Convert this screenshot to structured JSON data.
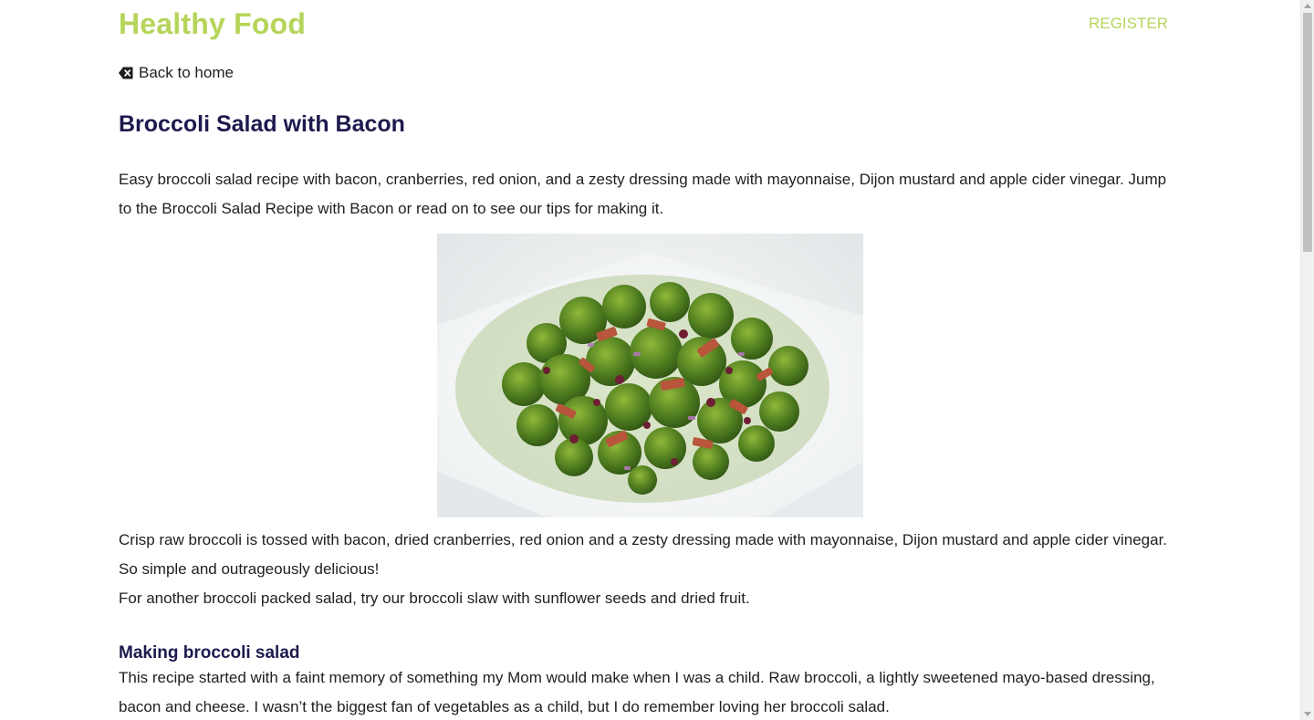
{
  "header": {
    "logo": "Healthy Food",
    "register_label": "REGISTER",
    "brand_color": "#b5d55a"
  },
  "nav": {
    "back_icon": "backspace-icon",
    "back_label": "Back to home"
  },
  "article": {
    "title": "Broccoli Salad with Bacon",
    "intro": "Easy broccoli salad recipe with bacon, cranberries, red onion, and a zesty dressing made with mayonnaise, Dijon mustard and apple cider vinegar. Jump to the Broccoli Salad Recipe with Bacon or read on to see our tips for making it.",
    "image_alt": "Broccoli salad with bacon on a white plate",
    "description": "Crisp raw broccoli is tossed with bacon, dried cranberries, red onion and a zesty dressing made with mayonnaise, Dijon mustard and apple cider vinegar. So simple and outrageously delicious!",
    "description2": "For another broccoli packed salad, try our broccoli slaw with sunflower seeds and dried fruit.",
    "section_title": "Making broccoli salad",
    "section_text": "This recipe started with a faint memory of something my Mom would make when I was a child. Raw broccoli, a lightly sweetened mayo-based dressing, bacon and cheese. I wasn’t the biggest fan of vegetables as a child, but I do remember loving her broccoli salad.",
    "heading_color": "#1d1a4e"
  },
  "scrollbar": {
    "position": 0
  }
}
